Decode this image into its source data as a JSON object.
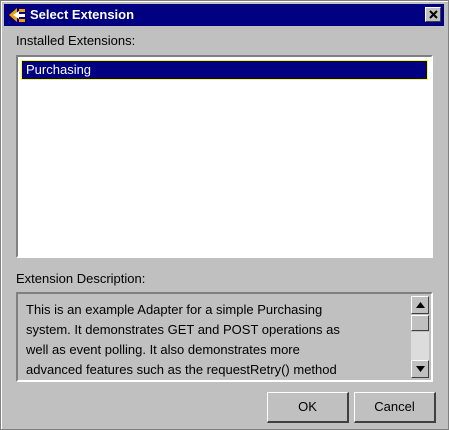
{
  "window": {
    "title": "Select Extension",
    "icon": "java-cup-icon",
    "close_icon": "close-icon"
  },
  "installed": {
    "label": "Installed Extensions:",
    "items": [
      {
        "label": "Purchasing",
        "selected": true
      }
    ]
  },
  "description": {
    "label": "Extension Description:",
    "lines": [
      "This is an example Adapter for a simple Purchasing",
      "system.  It demonstrates GET and POST operations as",
      "well as event polling.  It also demonstrates more",
      "advanced features such as the requestRetry() method"
    ]
  },
  "buttons": {
    "ok_label": "OK",
    "cancel_label": "Cancel"
  },
  "colors": {
    "title_bar": "#000080",
    "selection": "#000080",
    "dialog_bg": "#c0c0c0"
  }
}
